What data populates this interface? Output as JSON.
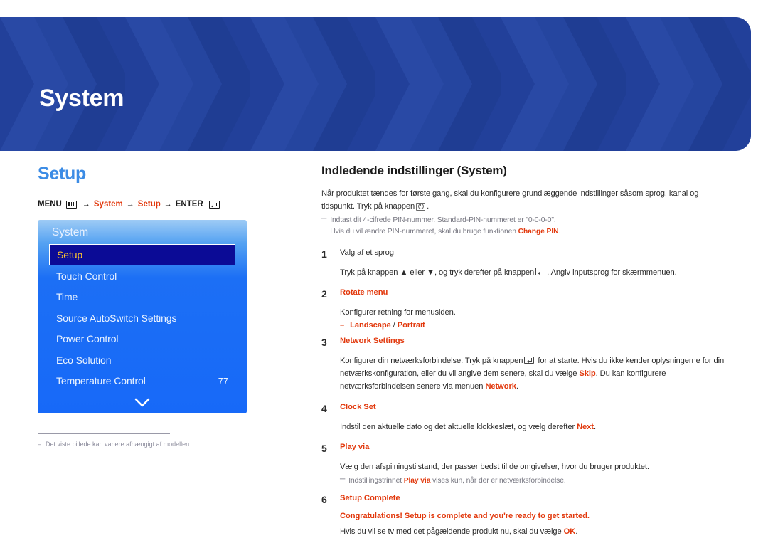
{
  "colors": {
    "banner_blue": "#22409A",
    "accent_red": "#E2380C",
    "heading_blue": "#3C8CE5",
    "osd_blue": "#1769F8",
    "osd_selected_bg": "#0B0B96",
    "osd_selected_text": "#FFC62E"
  },
  "banner": {
    "title": "System"
  },
  "left": {
    "section_title": "Setup",
    "breadcrumb": {
      "menu_label": "MENU",
      "menu_icon": "menu-bars-icon",
      "arrow1": "→",
      "crumb1": "System",
      "arrow2": "→",
      "crumb2": "Setup",
      "arrow3": "→",
      "enter_label": "ENTER",
      "enter_icon": "enter-key-icon"
    },
    "osd": {
      "header": "System",
      "items": [
        {
          "label": "Setup",
          "value": "",
          "selected": true
        },
        {
          "label": "Touch Control",
          "value": "",
          "selected": false
        },
        {
          "label": "Time",
          "value": "",
          "selected": false
        },
        {
          "label": "Source AutoSwitch Settings",
          "value": "",
          "selected": false
        },
        {
          "label": "Power Control",
          "value": "",
          "selected": false
        },
        {
          "label": "Eco Solution",
          "value": "",
          "selected": false
        },
        {
          "label": "Temperature Control",
          "value": "77",
          "selected": false
        }
      ],
      "scroll_icon": "chevron-down-icon"
    },
    "footnote": {
      "dash": "–",
      "text": "Det viste billede kan variere afhængigt af modellen."
    }
  },
  "right": {
    "article_title": "Indledende indstillinger (System)",
    "intro_part1": "Når produktet tændes for første gang, skal du konfigurere grundlæggende indstillinger såsom sprog, kanal og tidspunkt. Tryk på knappen",
    "intro_part2": ".",
    "intro_power_icon": "power-button-icon",
    "intro_note": {
      "dash": "─",
      "line1": "Indtast dit 4-cifrede PIN-nummer. Standard-PIN-nummeret er \"0-0-0-0\".",
      "line2_pre": "Hvis du vil ændre PIN-nummeret, skal du bruge funktionen ",
      "line2_bold": "Change PIN",
      "line2_post": "."
    },
    "steps": [
      {
        "num": "1",
        "head": "Valg af et sprog",
        "head_style": "plain",
        "body_pre": "Tryk på knappen ▲ eller ▼, og tryk derefter på knappen",
        "body_post": ". Angiv inputsprog for skærmmenuen.",
        "enter_icon": "enter-key-icon"
      },
      {
        "num": "2",
        "head": "Rotate menu",
        "head_style": "accent",
        "body": "Konfigurer retning for menusiden.",
        "bullet": {
          "dash": "–",
          "opt1": "Landscape",
          "sep": " / ",
          "opt2": "Portrait"
        }
      },
      {
        "num": "3",
        "head": "Network Settings",
        "head_style": "accent",
        "body_p1": "Konfigurer din netværksforbindelse. Tryk på knappen",
        "body_p2": " for at starte. Hvis du ikke kender oplysningerne for din netværkskonfiguration, eller du vil angive dem senere, skal du vælge ",
        "body_b1": "Skip",
        "body_p3": ". Du kan konfigurere netværksforbindelsen senere via menuen ",
        "body_b2": "Network",
        "body_p4": ".",
        "enter_icon": "enter-key-icon"
      },
      {
        "num": "4",
        "head": "Clock Set",
        "head_style": "accent",
        "body_pre": "Indstil den aktuelle dato og det aktuelle klokkeslæt, og vælg derefter ",
        "body_bold": "Next",
        "body_post": "."
      },
      {
        "num": "5",
        "head": "Play via",
        "head_style": "accent",
        "body": "Vælg den afspilningstilstand, der passer bedst til de omgivelser, hvor du bruger produktet.",
        "note": {
          "dash": "─",
          "pre": "Indstillingstrinnet ",
          "bold": "Play via",
          "post": " vises kun, når der er netværksforbindelse."
        }
      },
      {
        "num": "6",
        "head": "Setup Complete",
        "head_style": "accent",
        "congrats": "Congratulations! Setup is complete and you're ready to get started.",
        "body_pre": "Hvis du vil se tv med det pågældende produkt nu, skal du vælge ",
        "body_bold": "OK",
        "body_post": "."
      }
    ]
  }
}
